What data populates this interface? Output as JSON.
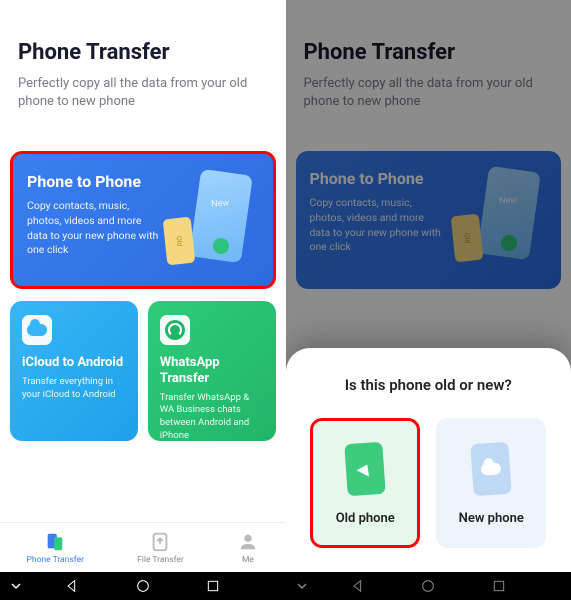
{
  "left": {
    "title": "Phone Transfer",
    "subtitle": "Perfectly copy all the data from your old phone to new phone",
    "hero": {
      "title": "Phone to Phone",
      "desc": "Copy contacts, music, photos, videos and more data to your new phone with one click",
      "new_label": "New",
      "old_label": "Old"
    },
    "icloud": {
      "title": "iCloud to Android",
      "desc": "Transfer everything in your iCloud to Android"
    },
    "whatsapp": {
      "title": "WhatsApp Transfer",
      "desc": "Transfer WhatsApp & WA Business chats between Android and iPhone"
    },
    "tabs": {
      "phone_transfer": "Phone Transfer",
      "file_transfer": "File Transfer",
      "me": "Me"
    }
  },
  "right": {
    "title": "Phone Transfer",
    "subtitle": "Perfectly copy all the data from your old phone to new phone",
    "hero": {
      "title": "Phone to Phone",
      "desc": "Copy contacts, music, photos, videos and more data to your new phone with one click",
      "new_label": "New",
      "old_label": "Old"
    },
    "sheet": {
      "question": "Is this phone old or new?",
      "old_label": "Old phone",
      "new_label": "New phone"
    }
  }
}
